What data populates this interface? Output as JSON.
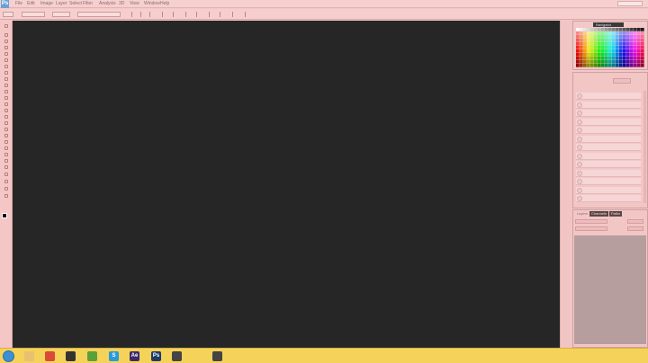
{
  "app": {
    "logo_text": "Ps"
  },
  "menu": {
    "items": [
      "File",
      "Edit",
      "Image",
      "Layer",
      "Select",
      "Filter",
      "Analysis",
      "3D",
      "View",
      "Window",
      "Help"
    ]
  },
  "navigator": {
    "tab_label": "Navigator"
  },
  "layers": {
    "tabs": [
      "Layers",
      "Channels",
      "Paths"
    ]
  },
  "taskbar": {
    "icons": [
      {
        "name": "explorer-icon",
        "glyph": "",
        "color": "#e8c070"
      },
      {
        "name": "chrome-icon",
        "glyph": "",
        "color": "#d94a3a"
      },
      {
        "name": "paint-icon",
        "glyph": "",
        "color": "#333333"
      },
      {
        "name": "spotify-icon",
        "glyph": "",
        "color": "#5aa03a"
      },
      {
        "name": "skype-icon",
        "glyph": "S",
        "color": "#2a9ad8"
      },
      {
        "name": "aftereffects-icon",
        "glyph": "Ae",
        "color": "#3a2a6a"
      },
      {
        "name": "photoshop-icon",
        "glyph": "Ps",
        "color": "#1f3a68"
      },
      {
        "name": "app-icon",
        "glyph": "",
        "color": "#444444"
      },
      {
        "name": "app2-icon",
        "glyph": "",
        "color": "#444444"
      }
    ]
  },
  "colors": {
    "canvas": "#262626",
    "chrome": "#f4c8c8",
    "taskbar": "#f5d25a"
  }
}
